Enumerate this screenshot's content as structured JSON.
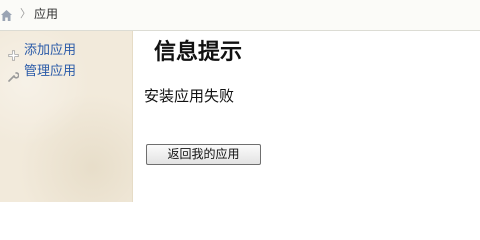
{
  "breadcrumb": {
    "separator": "〉",
    "current": "应用"
  },
  "sidebar": {
    "items": [
      {
        "label": "添加应用",
        "icon": "plus-icon"
      },
      {
        "label": "管理应用",
        "icon": "wrench-icon"
      }
    ]
  },
  "main": {
    "title": "信息提示",
    "message": "安装应用失败",
    "back_button_label": "返回我的应用"
  },
  "colors": {
    "sidebar_bg": "#f2eadb",
    "link": "#2a5aa8"
  }
}
